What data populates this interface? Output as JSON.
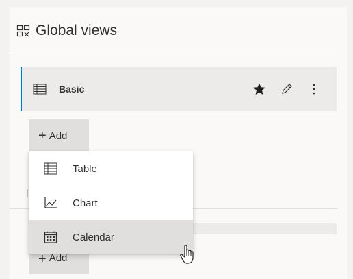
{
  "header": {
    "title": "Global views",
    "icon": "views-gallery-icon"
  },
  "views": [
    {
      "label": "Basic",
      "icon": "table-icon",
      "favorite": true
    }
  ],
  "add_button": {
    "label": "Add"
  },
  "add_menu": {
    "items": [
      {
        "label": "Table",
        "icon": "table-icon"
      },
      {
        "label": "Chart",
        "icon": "line-chart-icon"
      },
      {
        "label": "Calendar",
        "icon": "calendar-icon",
        "highlighted": true
      }
    ]
  },
  "second_add_button": {
    "label": "Add"
  },
  "colors": {
    "accent": "#0078d4",
    "background": "#f3f2f1",
    "row_background": "#edebe9",
    "highlight": "#e1dfdd"
  }
}
